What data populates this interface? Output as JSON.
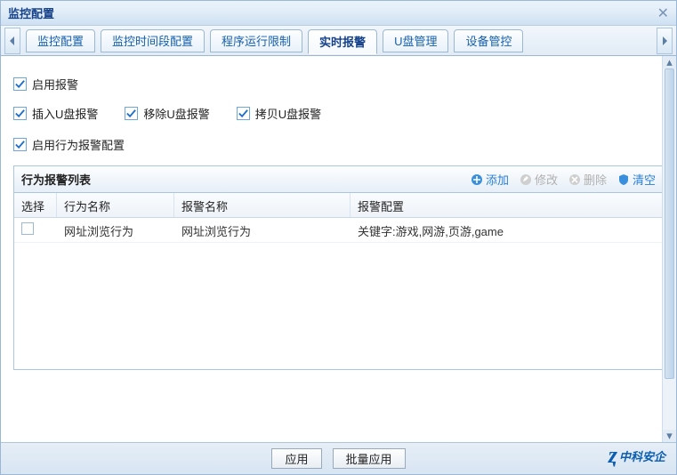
{
  "window": {
    "title": "监控配置"
  },
  "tabs": {
    "items": [
      {
        "label": "监控配置"
      },
      {
        "label": "监控时间段配置"
      },
      {
        "label": "程序运行限制"
      },
      {
        "label": "实时报警"
      },
      {
        "label": "U盘管理"
      },
      {
        "label": "设备管控"
      }
    ],
    "active_index": 3
  },
  "checks": {
    "enable_alarm": "启用报警",
    "usb_insert": "插入U盘报警",
    "usb_remove": "移除U盘报警",
    "usb_copy": "拷贝U盘报警",
    "enable_behavior": "启用行为报警配置"
  },
  "panel": {
    "title": "行为报警列表",
    "actions": {
      "add": "添加",
      "edit": "修改",
      "delete": "删除",
      "clear": "清空"
    },
    "columns": {
      "select": "选择",
      "name": "行为名称",
      "alarm": "报警名称",
      "config": "报警配置"
    },
    "rows": [
      {
        "name": "网址浏览行为",
        "alarm": "网址浏览行为",
        "config": "关键字:游戏,网游,页游,game"
      }
    ]
  },
  "footer": {
    "apply": "应用",
    "batch_apply": "批量应用"
  },
  "brand": {
    "text": "中科安企"
  }
}
